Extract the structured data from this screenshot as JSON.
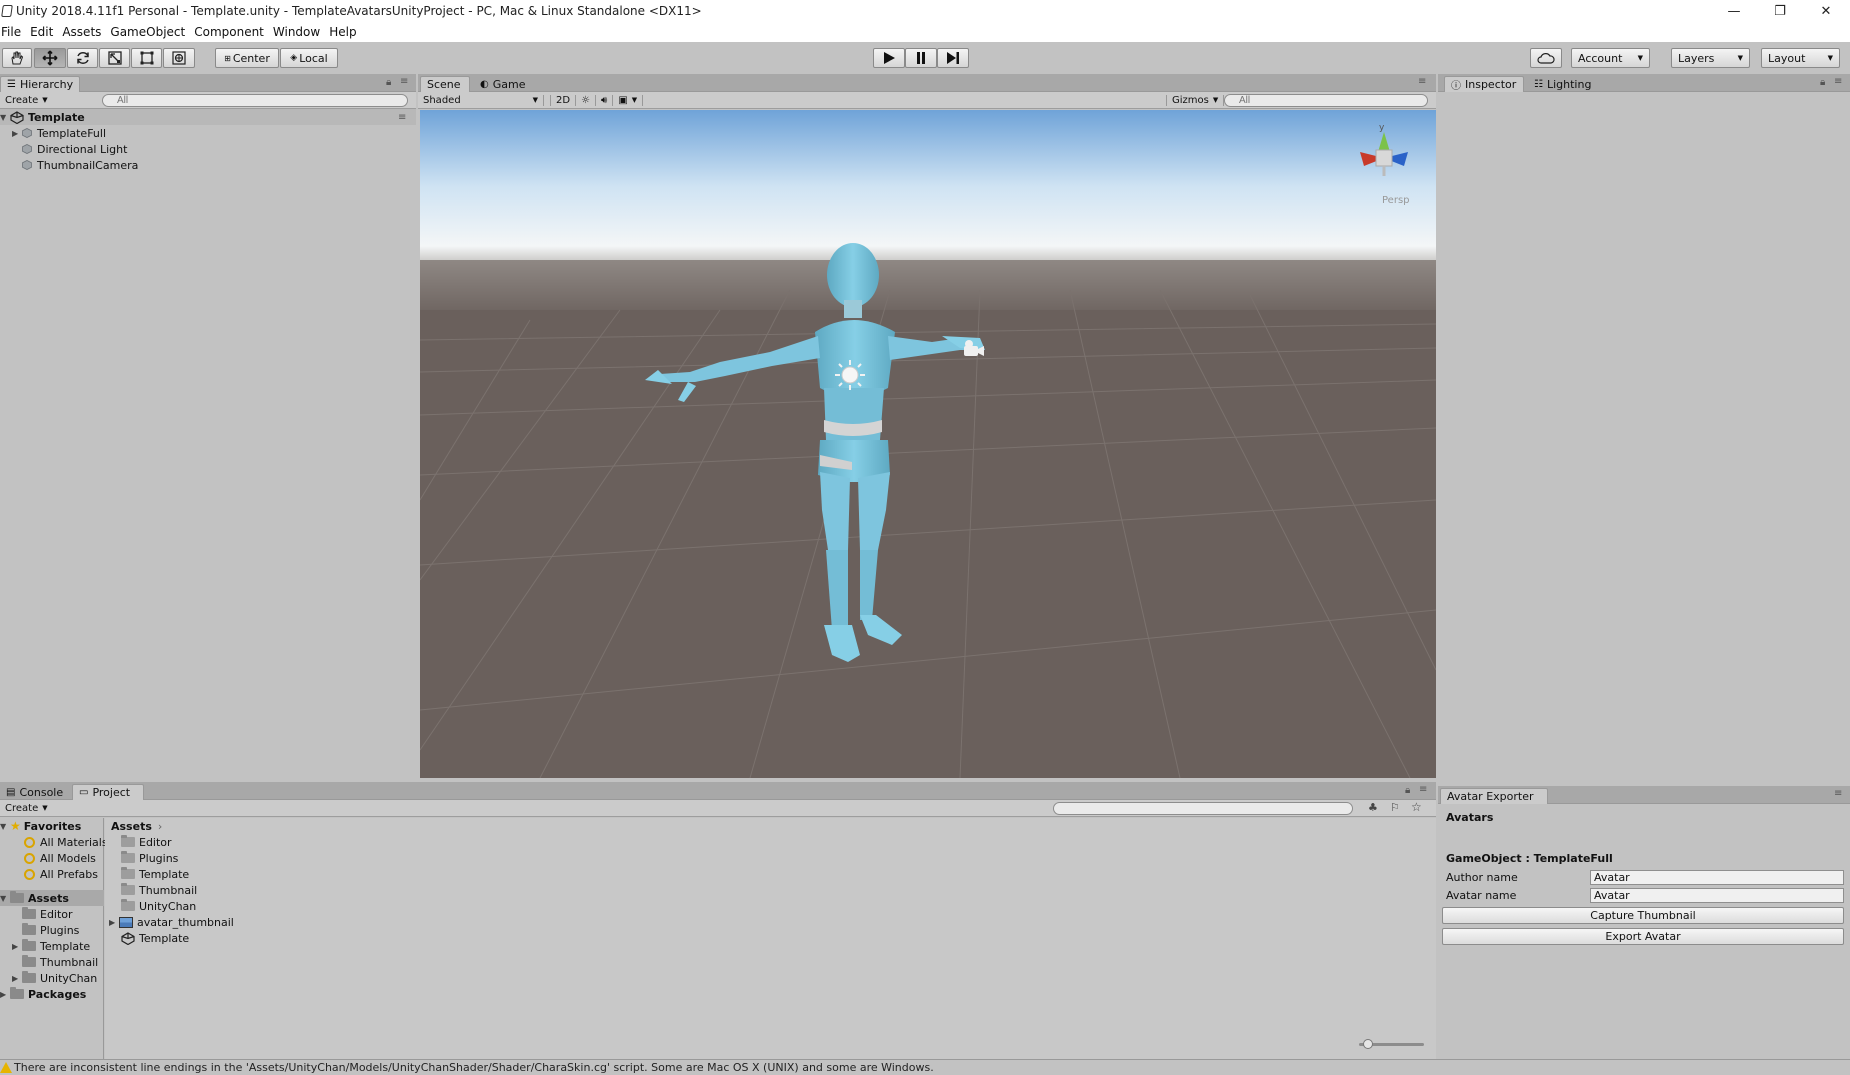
{
  "window": {
    "title": "Unity 2018.4.11f1 Personal - Template.unity - TemplateAvatarsUnityProject - PC, Mac & Linux Standalone <DX11>",
    "minimize": "—",
    "restore": "❐",
    "close": "✕"
  },
  "menu": [
    "File",
    "Edit",
    "Assets",
    "GameObject",
    "Component",
    "Window",
    "Help"
  ],
  "toolbar": {
    "tools": [
      "hand-icon",
      "move-icon",
      "rotate-icon",
      "scale-icon",
      "rect-icon",
      "transform-icon"
    ],
    "pivot_mode": "Center",
    "pivot_rotation": "Local",
    "account": "Account",
    "layers": "Layers",
    "layout": "Layout"
  },
  "hierarchy": {
    "tab": "Hierarchy",
    "create": "Create",
    "search_placeholder": "All",
    "scene_name": "Template",
    "items": [
      "TemplateFull",
      "Directional Light",
      "ThumbnailCamera"
    ]
  },
  "scene": {
    "tabs": [
      "Scene",
      "Game"
    ],
    "shading": "Shaded",
    "mode_2d": "2D",
    "gizmos": "Gizmos",
    "search_placeholder": "All",
    "persp_label": "Persp",
    "gizmo_y": "y"
  },
  "inspector": {
    "tabs": [
      "Inspector",
      "Lighting"
    ]
  },
  "project": {
    "tabs": [
      "Console",
      "Project"
    ],
    "create": "Create",
    "favorites": {
      "label": "Favorites",
      "items": [
        "All Materials",
        "All Models",
        "All Prefabs"
      ]
    },
    "assets_tree": {
      "label": "Assets",
      "items": [
        "Editor",
        "Plugins",
        "Template",
        "Thumbnail",
        "UnityChan"
      ]
    },
    "packages": "Packages",
    "breadcrumb": "Assets",
    "asset_items": [
      "Editor",
      "Plugins",
      "Template",
      "Thumbnail",
      "UnityChan",
      "avatar_thumbnail",
      "Template"
    ]
  },
  "avatar_exporter": {
    "tab": "Avatar Exporter",
    "heading": "Avatars",
    "gameobject_label": "GameObject : TemplateFull",
    "author_label": "Author name",
    "author_value": "Avatar",
    "avatar_label": "Avatar name",
    "avatar_value": "Avatar",
    "capture_button": "Capture Thumbnail",
    "export_button": "Export Avatar"
  },
  "status": {
    "message": "There are inconsistent line endings in the 'Assets/UnityChan/Models/UnityChanShader/Shader/CharaSkin.cg' script. Some are Mac OS X (UNIX) and some are Windows."
  },
  "colors": {
    "editor_bg": "#c2c2c2",
    "sky_top": "#6fa3d8",
    "ground": "#6a605c",
    "avatar": "#79c6de",
    "warning": "#e7b400"
  }
}
